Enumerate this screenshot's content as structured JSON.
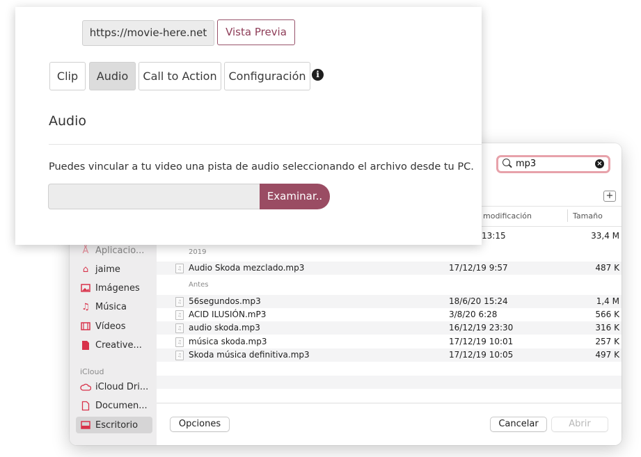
{
  "web": {
    "url_value": "https://movie-here.net",
    "preview_label": "Vista Previa",
    "tabs": [
      {
        "label": "Clip",
        "active": false
      },
      {
        "label": "Audio",
        "active": true
      },
      {
        "label": "Call to Action",
        "active": false
      },
      {
        "label": "Configuración",
        "active": false
      }
    ],
    "info_icon": "info-icon",
    "section_title": "Audio",
    "description": "Puedes vincular a tu video una pista de audio seleccionando el archivo desde tu PC.",
    "file_value": "",
    "browse_label": "Examinar..",
    "accent_color": "#9a4c63"
  },
  "dialog": {
    "search": {
      "value": "mp3",
      "clear_icon": "clear-icon"
    },
    "columns": {
      "modified": "modificación",
      "size": "Tamaño"
    },
    "partial_row": {
      "date": "13:15",
      "size": "33,4 M"
    },
    "sidebar": {
      "items": [
        {
          "label": "Aplicacio...",
          "icon": "applications-icon"
        },
        {
          "label": "jaime",
          "icon": "home-icon"
        },
        {
          "label": "Imágenes",
          "icon": "pictures-icon"
        },
        {
          "label": "Música",
          "icon": "music-icon"
        },
        {
          "label": "Vídeos",
          "icon": "videos-icon"
        },
        {
          "label": "Creative...",
          "icon": "document-icon"
        }
      ],
      "icloud_header": "iCloud",
      "icloud_items": [
        {
          "label": "iCloud Dri...",
          "icon": "cloud-icon"
        },
        {
          "label": "Documen...",
          "icon": "document-icon"
        },
        {
          "label": "Escritorio",
          "icon": "desktop-icon",
          "selected": true
        }
      ]
    },
    "groups": {
      "g2019": "2019",
      "older": "Antes"
    },
    "files": [
      {
        "name": "Audio Skoda mezclado.mp3",
        "date": "17/12/19 9:57",
        "size": "487 K"
      },
      {
        "name": "56segundos.mp3",
        "date": "18/6/20 15:24",
        "size": "1,4 M"
      },
      {
        "name": "ACID ILUSIÓN.mP3",
        "date": "3/8/20 6:28",
        "size": "566 K"
      },
      {
        "name": "audio skoda.mp3",
        "date": "16/12/19 23:30",
        "size": "316 K"
      },
      {
        "name": "música skoda.mp3",
        "date": "17/12/19 10:01",
        "size": "257 K"
      },
      {
        "name": "Skoda música definitiva.mp3",
        "date": "17/12/19 10:05",
        "size": "497 K"
      }
    ],
    "buttons": {
      "options": "Opciones",
      "cancel": "Cancelar",
      "open": "Abrir"
    }
  }
}
